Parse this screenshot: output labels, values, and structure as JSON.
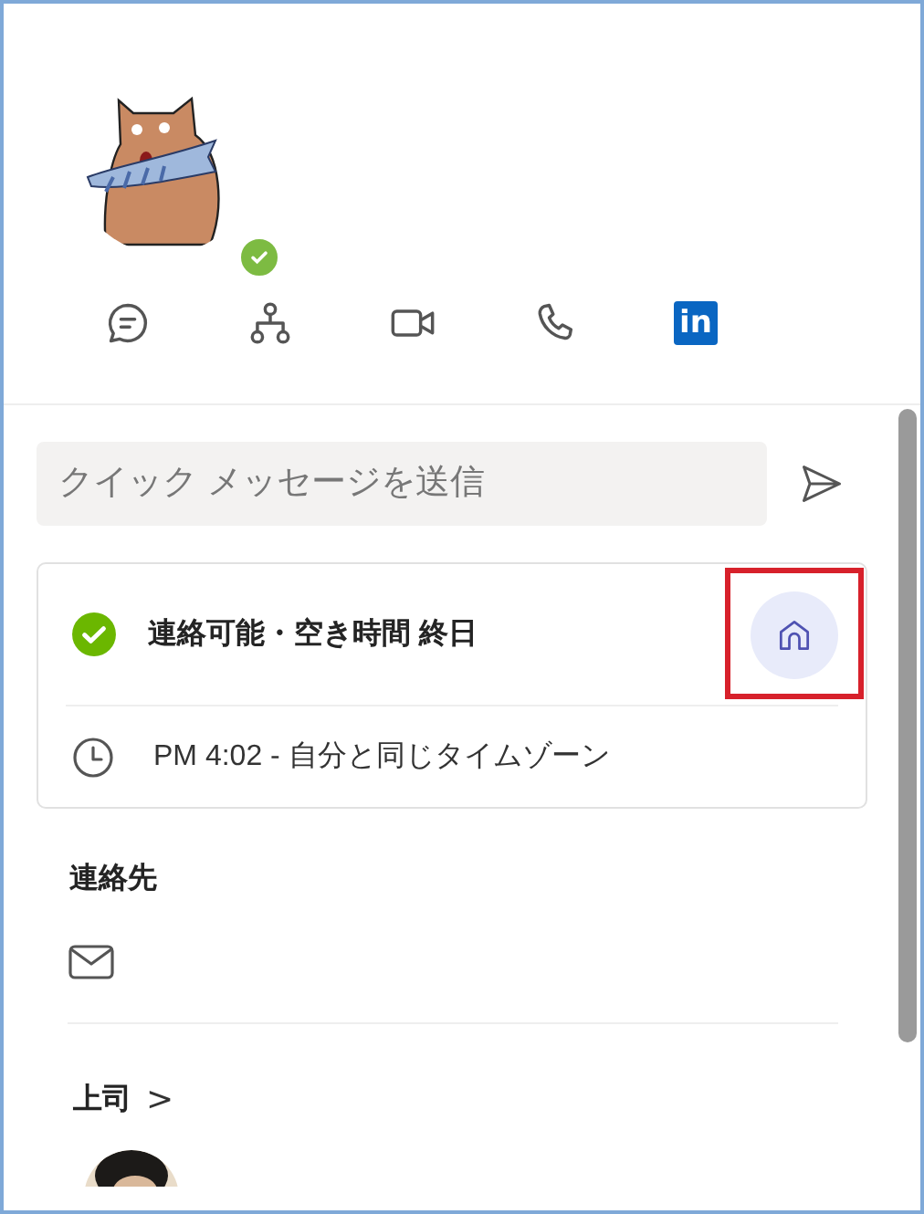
{
  "profile": {
    "available": true
  },
  "actions": [
    {
      "kind": "chat"
    },
    {
      "kind": "org"
    },
    {
      "kind": "video"
    },
    {
      "kind": "call"
    },
    {
      "kind": "linkedin",
      "label": "in"
    }
  ],
  "quick_message": {
    "placeholder": "クイック メッセージを送信"
  },
  "status_card": {
    "status": "連絡可能・空き時間 終日",
    "work_location": {
      "kind": "home",
      "highlighted": true
    },
    "local_time": "PM 4:02 - 自分と同じタイムゾーン"
  },
  "contact": {
    "heading": "連絡先"
  },
  "manager": {
    "heading": "上司",
    "chevron": ">"
  }
}
